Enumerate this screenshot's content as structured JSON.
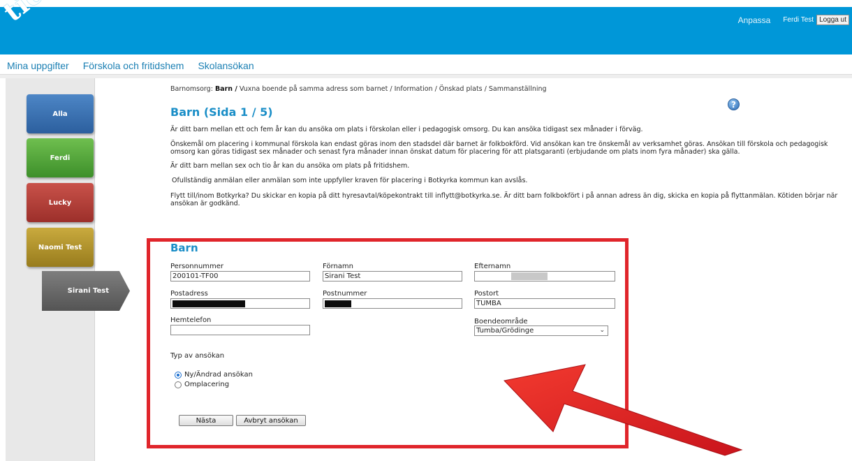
{
  "header": {
    "logo": "tieto",
    "customize_label": "Anpassa",
    "user_name": "Ferdi Test",
    "logout_label": "Logga ut"
  },
  "topnav": [
    "Mina uppgifter",
    "Förskola och fritidshem",
    "Skolansökan"
  ],
  "sidebar": {
    "items": [
      "Alla",
      "Ferdi",
      "Lucky",
      "Naomi Test"
    ],
    "active": "Sirani Test"
  },
  "breadcrumb": {
    "prefix": "Barnomsorg:",
    "current": "Barn /",
    "rest": " Vuxna boende på samma adress som barnet / Information / Önskad plats / Sammanställning"
  },
  "page_title": "Barn (Sida 1 / 5)",
  "paragraphs": [
    "Är ditt barn mellan ett och fem år kan du ansöka om plats i förskolan eller i pedagogisk omsorg. Du kan ansöka tidigast sex månader i förväg.",
    "Önskemål om placering i kommunal förskola kan endast göras inom den stadsdel där barnet är folkbokförd. Vid ansökan kan tre önskemål av verksamhet göras. Ansökan till förskola och pedagogisk omsorg kan göras tidigast sex månader och senast fyra månader innan önskat datum för placering för att platsgaranti (erbjudande om plats inom fyra månader) ska gälla.",
    "Är ditt barn mellan sex och tio år kan du ansöka om plats på fritidshem.",
    "Ofullständig anmälan eller anmälan som inte uppfyller kraven för placering i Botkyrka kommun kan avslås.",
    "Flytt till/inom Botkyrka? Du skickar en kopia på ditt hyresavtal/köpekontrakt till inflytt@botkyrka.se. Är ditt barn folkbokfört i på annan adress än dig, skicka en kopia på flyttanmälan. Kötiden börjar när ansökan är godkänd."
  ],
  "form": {
    "title": "Barn",
    "personnummer_label": "Personnummer",
    "personnummer_value": "200101-TF00",
    "fornamn_label": "Förnamn",
    "fornamn_value": "Sirani Test",
    "efternamn_label": "Efternamn",
    "postadress_label": "Postadress",
    "postnummer_label": "Postnummer",
    "postort_label": "Postort",
    "postort_value": "TUMBA",
    "hemtelefon_label": "Hemtelefon",
    "boendeomrade_label": "Boendeområde",
    "boendeomrade_value": "Tumba/Grödinge",
    "typ_label": "Typ av ansökan",
    "radio_new": "Ny/Ändrad ansökan",
    "radio_move": "Omplacering",
    "next_button": "Nästa",
    "cancel_button": "Avbryt ansökan"
  },
  "colors": {
    "header_blue": "#0097d8",
    "link_blue": "#1a8ec7",
    "annotation_red": "#e0252b"
  }
}
